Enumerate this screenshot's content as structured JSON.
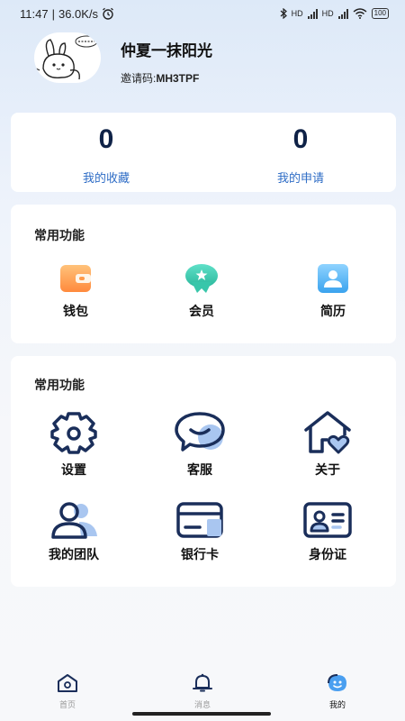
{
  "status_bar": {
    "time": "11:47",
    "speed": "36.0K/s",
    "network1": "HD",
    "network2": "HD",
    "battery": "100"
  },
  "profile": {
    "username": "仲夏一抹阳光",
    "invite_label": "邀请码:",
    "invite_code": "MH3TPF"
  },
  "stats": [
    {
      "value": "0",
      "label": "我的收藏"
    },
    {
      "value": "0",
      "label": "我的申请"
    }
  ],
  "common_functions": {
    "title": "常用功能",
    "items": [
      {
        "label": "钱包",
        "icon": "wallet-icon"
      },
      {
        "label": "会员",
        "icon": "vip-icon"
      },
      {
        "label": "简历",
        "icon": "resume-icon"
      }
    ]
  },
  "tools": {
    "title": "常用功能",
    "items": [
      {
        "label": "设置",
        "icon": "gear-icon"
      },
      {
        "label": "客服",
        "icon": "chat-icon"
      },
      {
        "label": "关于",
        "icon": "home-heart-icon"
      },
      {
        "label": "我的团队",
        "icon": "team-icon"
      },
      {
        "label": "银行卡",
        "icon": "bank-card-icon"
      },
      {
        "label": "身份证",
        "icon": "id-card-icon"
      }
    ]
  },
  "tab_bar": {
    "items": [
      {
        "label": "首页",
        "icon": "home-icon"
      },
      {
        "label": "消息",
        "icon": "bell-icon"
      },
      {
        "label": "我的",
        "icon": "profile-icon"
      }
    ],
    "active": "我的"
  },
  "colors": {
    "accent_blue": "#2f6dc6",
    "dark_navy": "#0f2247",
    "icon_blue": "#1a2e5a",
    "icon_light": "#a9c6f0"
  }
}
